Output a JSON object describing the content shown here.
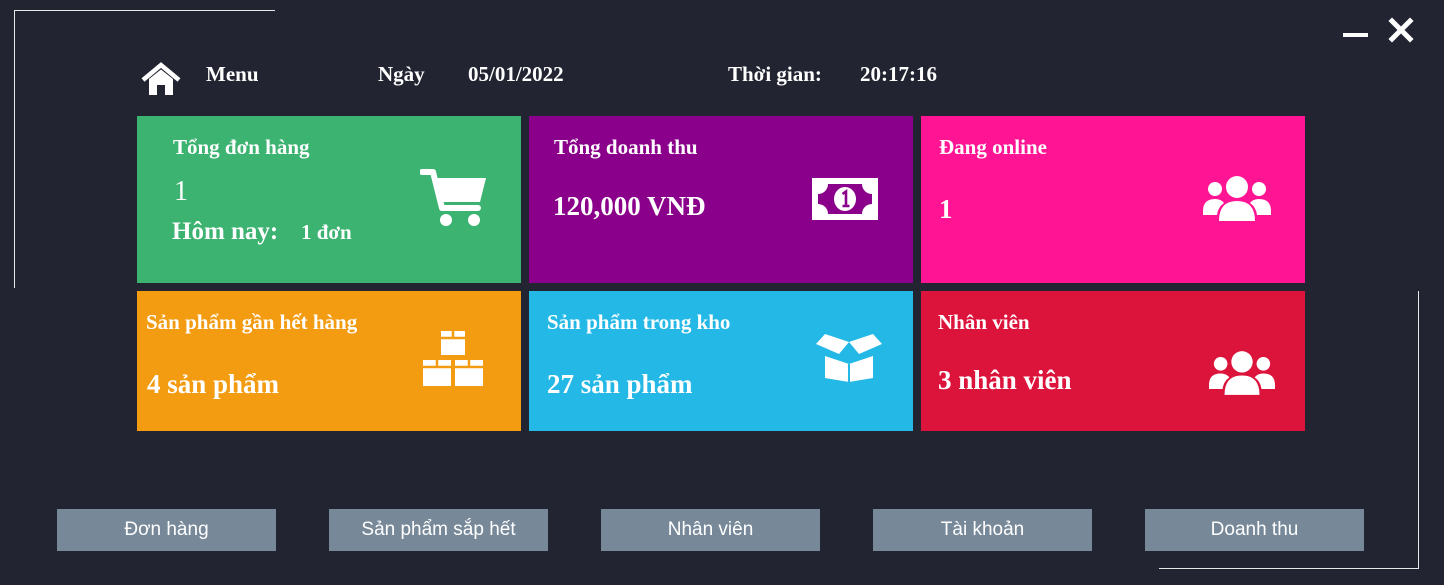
{
  "header": {
    "menu_label": "Menu",
    "date_label": "Ngày",
    "date_value": "05/01/2022",
    "time_label": "Thời gian:",
    "time_value": "20:17:16"
  },
  "tiles": {
    "orders": {
      "title": "Tổng đơn hàng",
      "value": "1",
      "today_label": "Hôm nay:",
      "today_value": "1 đơn",
      "color": "#3cb371",
      "icon": "shopping-cart-icon"
    },
    "revenue": {
      "title": "Tổng doanh thu",
      "value": "120,000 VNĐ",
      "color": "#8b008b",
      "icon": "money-bill-icon"
    },
    "online": {
      "title": "Đang online",
      "value": "1",
      "color": "#ff1493",
      "icon": "users-icon"
    },
    "low_stock": {
      "title": "Sản phẩm gần hết hàng",
      "value": "4 sản phẩm",
      "color": "#f39c12",
      "icon": "boxes-icon"
    },
    "in_stock": {
      "title": "Sản phẩm trong kho",
      "value": "27 sản phẩm",
      "color": "#24b8e6",
      "icon": "open-box-icon"
    },
    "staff": {
      "title": "Nhân viên",
      "value": "3 nhân viên",
      "color": "#dc143c",
      "icon": "users-icon"
    }
  },
  "nav": {
    "orders": "Đơn hàng",
    "low_stock": "Sản phẩm sắp hết",
    "staff": "Nhân viên",
    "accounts": "Tài khoản",
    "revenue": "Doanh thu"
  }
}
